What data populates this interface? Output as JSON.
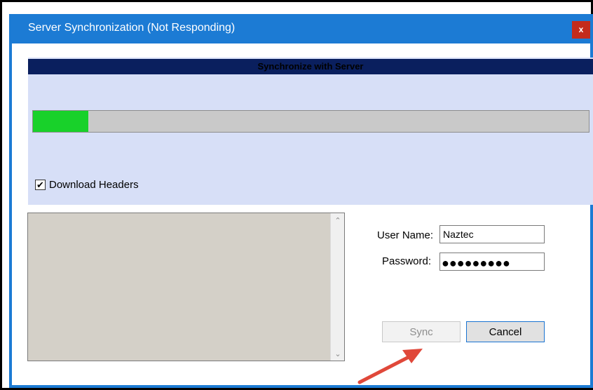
{
  "window": {
    "title": "Server Synchronization (Not Responding)",
    "close_label": "x"
  },
  "panel": {
    "header": "Synchronize with Server",
    "progress_fraction": 0.1,
    "download_headers": {
      "label": "Download Headers",
      "checked": true,
      "check_glyph": "✔"
    }
  },
  "log": {
    "scroll_up_glyph": "⌃",
    "scroll_down_glyph": "⌄"
  },
  "form": {
    "username": {
      "label": "User Name:",
      "value": "Naztec"
    },
    "password": {
      "label": "Password:",
      "masked": "●●●●●●●●●"
    }
  },
  "buttons": {
    "sync": "Sync",
    "cancel": "Cancel"
  },
  "colors": {
    "titlebar": "#1c7bd4",
    "progress": "#18d12a",
    "annotation_arrow": "#e0483a"
  }
}
